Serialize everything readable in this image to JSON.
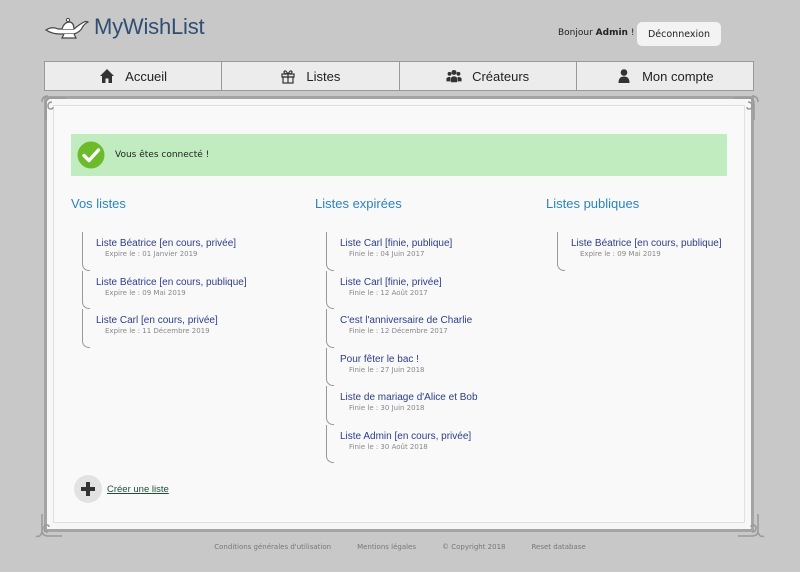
{
  "header": {
    "logo_text": "MyWishList",
    "greeting_prefix": "Bonjour ",
    "greeting_user": "Admin",
    "greeting_suffix": " !",
    "logout_label": "Déconnexion"
  },
  "nav": {
    "items": [
      {
        "label": "Accueil",
        "icon": "home-icon"
      },
      {
        "label": "Listes",
        "icon": "gift-icon"
      },
      {
        "label": "Créateurs",
        "icon": "people-icon"
      },
      {
        "label": "Mon compte",
        "icon": "user-icon"
      }
    ]
  },
  "alert": {
    "text": "Vous êtes connecté !",
    "icon": "check-circle-icon",
    "color": "#c0ecc0"
  },
  "columns": {
    "mine": {
      "title": "Vos listes",
      "items": [
        {
          "title": "Liste Béatrice [en cours, privée]",
          "sub": "Expire le : 01 Janvier 2019"
        },
        {
          "title": "Liste Béatrice [en cours, publique]",
          "sub": "Expire le : 09 Mai 2019"
        },
        {
          "title": "Liste Carl [en cours, privée]",
          "sub": "Expire le : 11 Décembre 2019"
        }
      ]
    },
    "expired": {
      "title": "Listes expirées",
      "items": [
        {
          "title": "Liste Carl [finie, publique]",
          "sub": "Finie le : 04 Juin 2017"
        },
        {
          "title": "Liste Carl [finie, privée]",
          "sub": "Finie le : 12 Août 2017"
        },
        {
          "title": "C'est l'anniversaire de Charlie",
          "sub": "Finie le : 12 Décembre 2017"
        },
        {
          "title": "Pour fêter le bac !",
          "sub": "Finie le : 27 Juin 2018"
        },
        {
          "title": "Liste de mariage d'Alice et Bob",
          "sub": "Finie le : 30 Juin 2018"
        },
        {
          "title": "Liste Admin [en cours, privée]",
          "sub": "Finie le : 30 Août 2018"
        }
      ]
    },
    "public": {
      "title": "Listes publiques",
      "items": [
        {
          "title": "Liste Béatrice [en cours, publique]",
          "sub": "Expire le : 09 Mai 2019"
        }
      ]
    }
  },
  "create": {
    "label": "Créer une liste",
    "icon": "plus-icon"
  },
  "footer": {
    "links": [
      "Conditions générales d'utilisation",
      "Mentions légales",
      "© Copyright 2018",
      "Reset database"
    ]
  },
  "colors": {
    "accent": "#2a84c2",
    "link": "#2c3d8a",
    "logo": "#2f4f72",
    "background": "#c8c8c8"
  }
}
